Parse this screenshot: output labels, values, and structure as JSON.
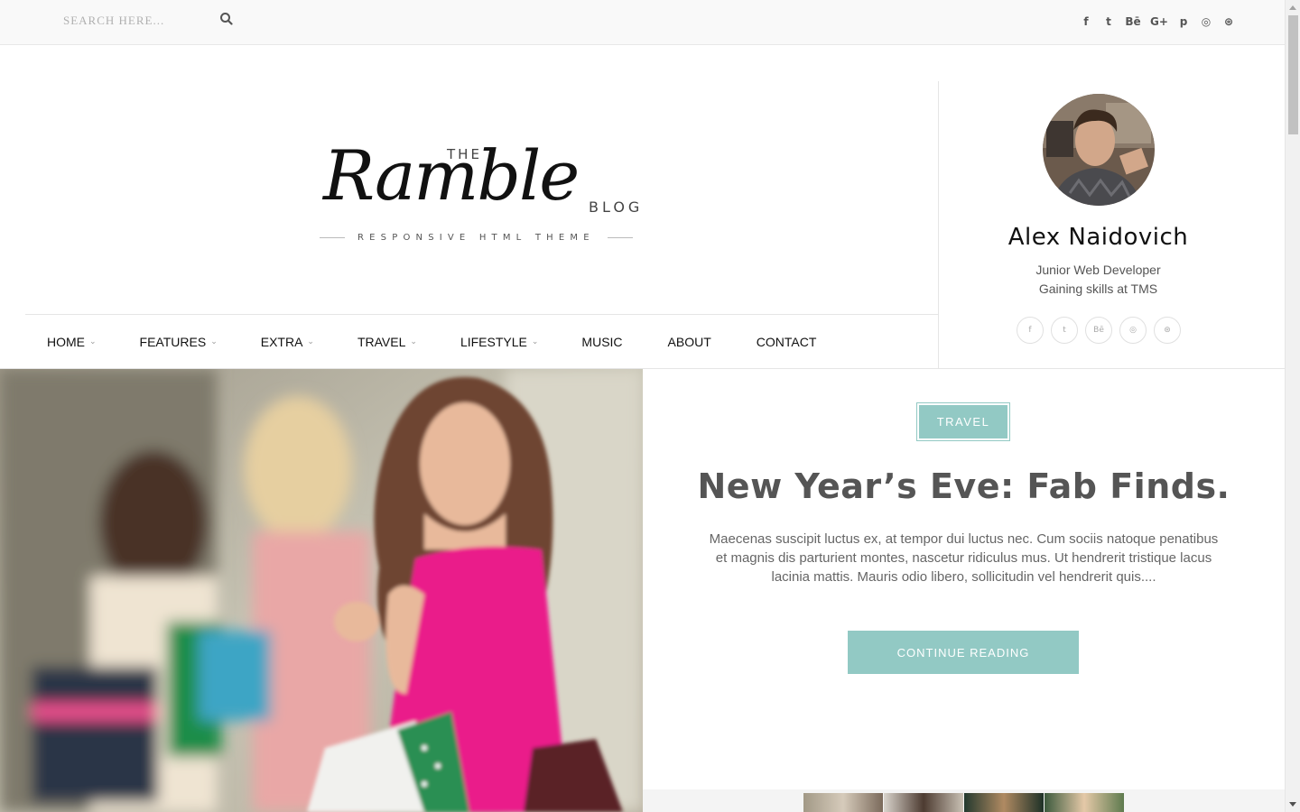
{
  "search": {
    "placeholder": "SEARCH HERE..."
  },
  "top_social": [
    "facebook-icon",
    "twitter-icon",
    "behance-icon",
    "google-plus-icon",
    "pinterest-icon",
    "instagram-icon",
    "dribbble-icon"
  ],
  "top_social_glyphs": {
    "facebook": "f",
    "twitter": "t",
    "behance": "Bē",
    "google_plus": "G+",
    "pinterest": "p",
    "instagram": "◎",
    "dribbble": "⊛"
  },
  "logo": {
    "the": "THE",
    "name": "Ramble",
    "blog": "BLOG",
    "tagline": "RESPONSIVE HTML THEME"
  },
  "nav": {
    "items": [
      {
        "label": "HOME",
        "dropdown": true
      },
      {
        "label": "FEATURES",
        "dropdown": true
      },
      {
        "label": "EXTRA",
        "dropdown": true
      },
      {
        "label": "TRAVEL",
        "dropdown": true
      },
      {
        "label": "LIFESTYLE",
        "dropdown": true
      },
      {
        "label": "MUSIC",
        "dropdown": false
      },
      {
        "label": "ABOUT",
        "dropdown": false
      },
      {
        "label": "CONTACT",
        "dropdown": false
      }
    ]
  },
  "profile": {
    "name": "Alex Naidovich",
    "role": "Junior Web Developer",
    "subtitle": "Gaining skills at TMS",
    "social_glyphs": {
      "facebook": "f",
      "twitter": "t",
      "behance": "Bē",
      "instagram": "◎",
      "dribbble": "⊛"
    }
  },
  "featured_post": {
    "category": "TRAVEL",
    "title": "New Year’s Eve: Fab Finds.",
    "excerpt": "Maecenas suscipit luctus ex, at tempor dui luctus nec. Cum sociis natoque penatibus et magnis dis parturient montes, nascetur ridiculus mus. Ut hendrerit tristique lacus lacinia mattis. Mauris odio libero, sollicitudin vel hendrerit quis....",
    "cta": "CONTINUE READING"
  },
  "colors": {
    "accent": "#92c9c4",
    "topbar_bg": "#f9f9f9",
    "text": "#222222",
    "muted": "#666666"
  }
}
